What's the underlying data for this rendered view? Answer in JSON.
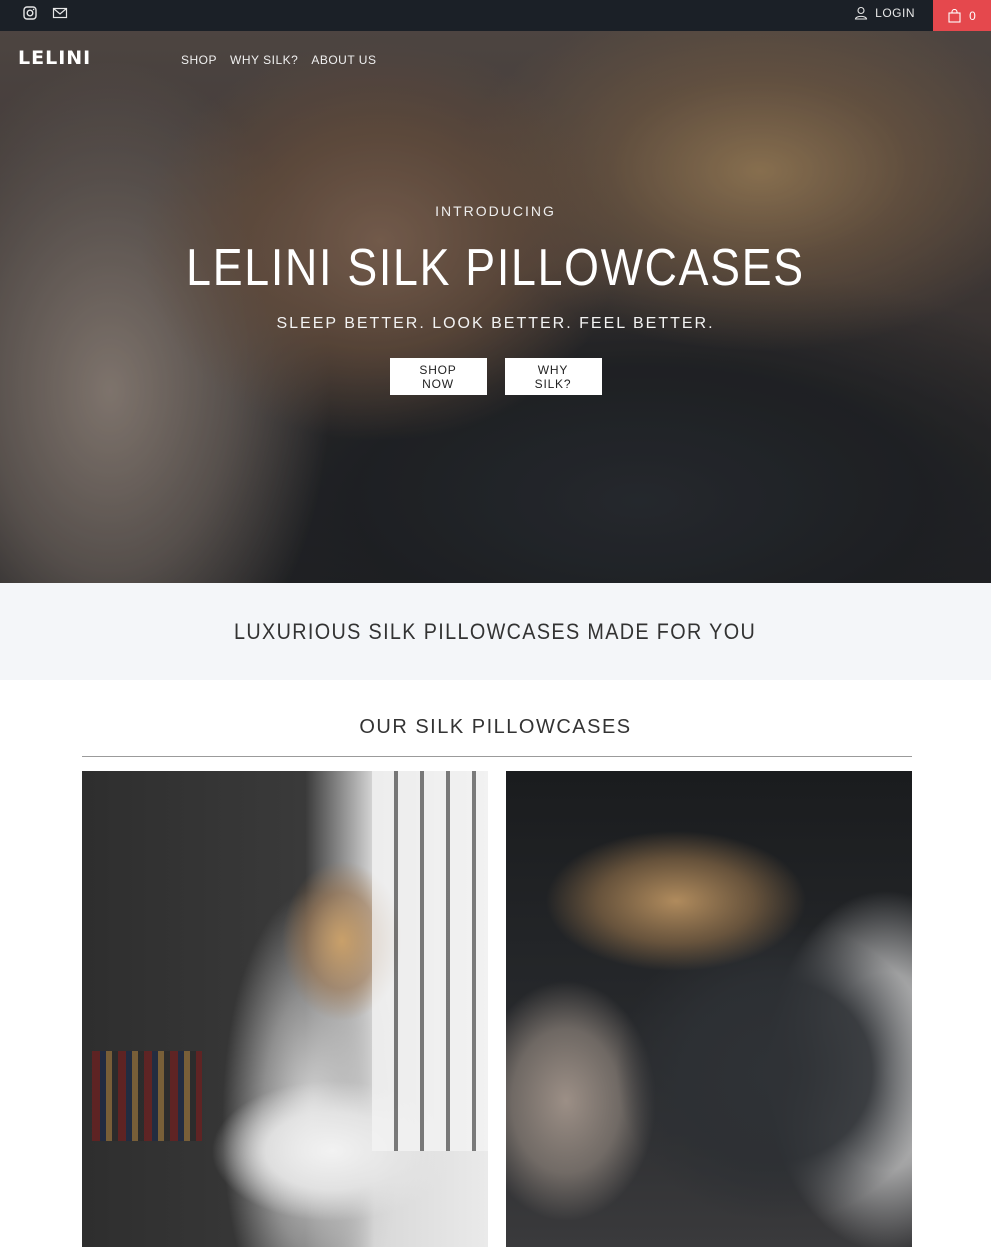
{
  "topbar": {
    "social": [
      {
        "name": "instagram-icon"
      },
      {
        "name": "mail-icon"
      }
    ],
    "login_label": "LOGIN",
    "cart_count": "0"
  },
  "header": {
    "logo": "LELINI",
    "nav": [
      "SHOP",
      "WHY SILK?",
      "ABOUT US"
    ]
  },
  "hero": {
    "eyebrow": "INTRODUCING",
    "headline": "LELINI SILK PILLOWCASES",
    "tagline": "SLEEP BETTER. LOOK BETTER. FEEL BETTER.",
    "buttons": [
      "SHOP NOW",
      "WHY SILK?"
    ]
  },
  "band": {
    "text": "LUXURIOUS SILK PILLOWCASES MADE FOR YOU"
  },
  "products": {
    "title": "OUR SILK PILLOWCASES"
  },
  "colors": {
    "topbar": "#1b2027",
    "cart": "#e5484d",
    "band": "#f4f6f9"
  }
}
